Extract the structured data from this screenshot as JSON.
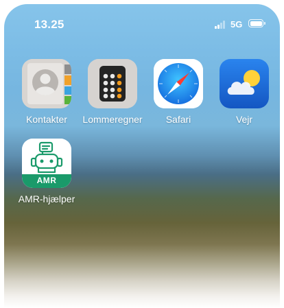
{
  "status_bar": {
    "time": "13.25",
    "network": "5G"
  },
  "apps": [
    {
      "label": "Kontakter",
      "icon": "contacts-icon"
    },
    {
      "label": "Lommeregner",
      "icon": "calculator-icon"
    },
    {
      "label": "Safari",
      "icon": "safari-compass-icon"
    },
    {
      "label": "Vejr",
      "icon": "weather-icon"
    },
    {
      "label": "AMR-hjælper",
      "icon": "robot-icon",
      "badge_text": "AMR"
    }
  ],
  "colors": {
    "amr_green": "#1a9a6a",
    "safari_blue": "#1e8fe8",
    "weather_blue": "#1f6fd6",
    "calculator_orange": "#f29a1c"
  }
}
